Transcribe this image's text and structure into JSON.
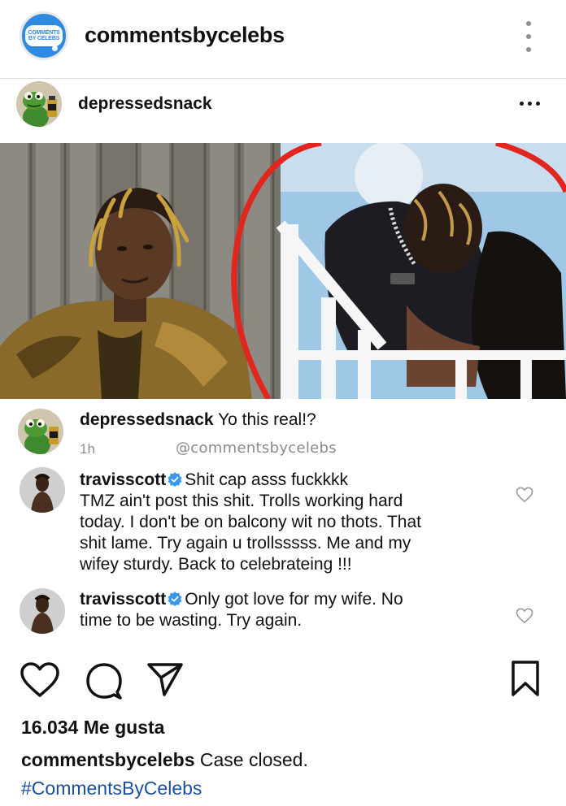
{
  "header": {
    "account_name": "commentsbycelebs",
    "logo_line1": "COMMENTS",
    "logo_line2": "BY CELEBS"
  },
  "inner_post": {
    "username": "depressedsnack"
  },
  "comments": [
    {
      "username": "depressedsnack",
      "text": "Yo this real!?",
      "time": "1h",
      "handle": "@commentsbycelebs",
      "verified": false
    },
    {
      "username": "travisscott",
      "verified": true,
      "first_line": "Shit cap asss fuckkkk",
      "lines": [
        "TMZ ain't post this shit. Trolls working hard",
        "today. I don't be on balcony wit no thots. That",
        "shit lame. Try again u trollsssss. Me and my",
        "wifey sturdy. Back to celebrateing !!!"
      ]
    },
    {
      "username": "travisscott",
      "verified": true,
      "first_line": "Only got love for my wife. No",
      "lines": [
        "time to be wasting. Try again."
      ]
    }
  ],
  "post": {
    "likes": "16.034 Me gusta",
    "caption_user": "commentsbycelebs",
    "caption_text": "Case closed.",
    "hashtag": "#CommentsByCelebs"
  },
  "colors": {
    "brand_blue": "#2f8be0",
    "verified_blue": "#3897f0",
    "hashtag_blue": "#1a4f9c",
    "circle_red": "#e0261e"
  },
  "icons": [
    "kebab-icon",
    "more-icon",
    "verified-icon",
    "heart-icon",
    "comment-icon",
    "share-icon",
    "bookmark-icon"
  ]
}
